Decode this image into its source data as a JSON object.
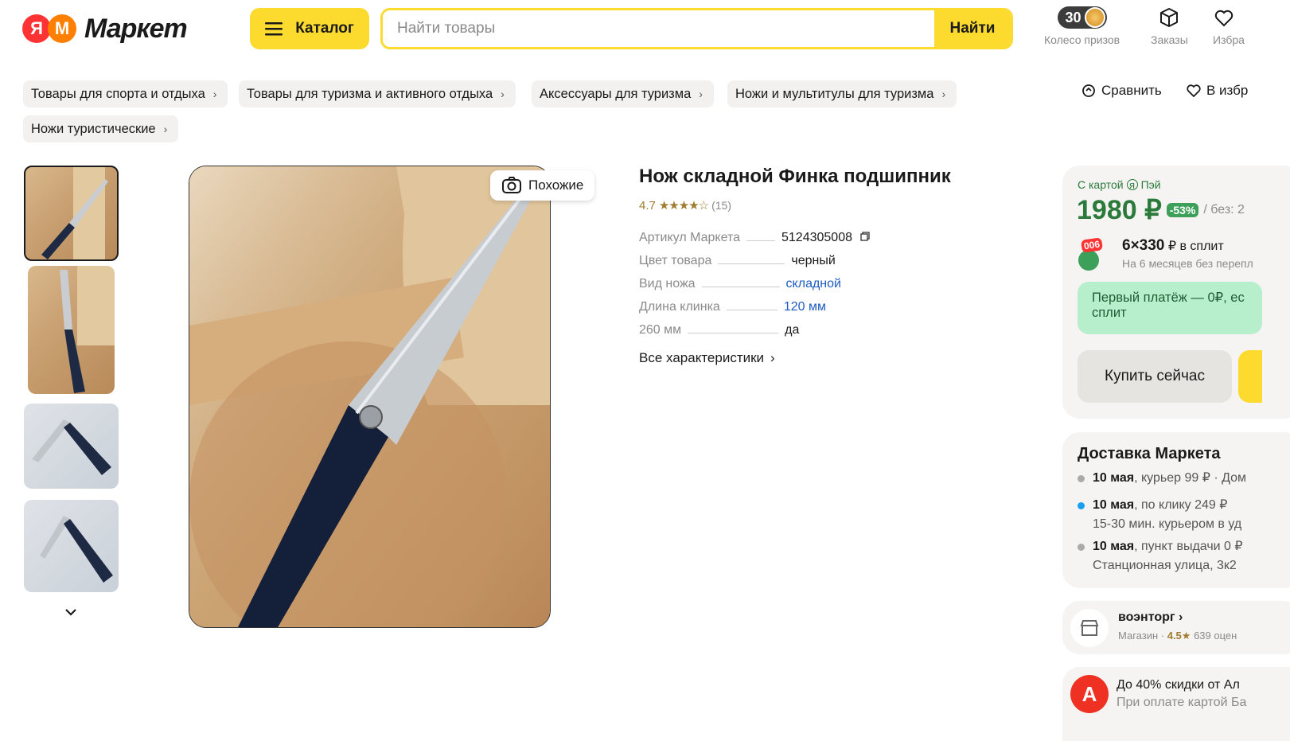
{
  "header": {
    "logo_letter": "Я",
    "logo_letter2": "М",
    "logo_word": "Маркет",
    "catalog_label": "Каталог",
    "search_placeholder": "Найти товары",
    "search_button": "Найти",
    "prize_count": "30",
    "prize_label": "Колесо призов",
    "orders_label": "Заказы",
    "favorites_label": "Избра"
  },
  "breadcrumbs": [
    "Товары для спорта и отдыха",
    "Товары для туризма и активного отдыха",
    "Аксессуары для туризма",
    "Ножи и мультитулы для туризма",
    "Ножи туристические"
  ],
  "actions": {
    "compare": "Сравнить",
    "favorite": "В избр"
  },
  "gallery": {
    "similar_label": "Похожие"
  },
  "product": {
    "title": "Нож складной Финка подшипник",
    "rating": "4.7",
    "reviews": "(15)",
    "specs": [
      {
        "name": "Артикул Маркета",
        "value": "5124305008"
      },
      {
        "name": "Цвет товара",
        "value": "черный"
      },
      {
        "name": "Вид ножа",
        "value": "складной"
      },
      {
        "name": "Длина клинка",
        "value": "120 мм"
      },
      {
        "name": "260 мм",
        "value": "да"
      }
    ],
    "all_chars": "Все характеристики"
  },
  "offer": {
    "card_label": "С картой",
    "pay_label": "Пэй",
    "price": "1980 ₽",
    "discount": "-53%",
    "without": "/ без: 2",
    "split_badge": "006",
    "split_price": "6×330",
    "split_suffix": "₽ в сплит",
    "split_note": "На 6 месяцев без перепл",
    "first_payment": "Первый платёж — 0₽, ес сплит",
    "buy_now": "Купить сейчас"
  },
  "delivery": {
    "title": "Доставка Маркета",
    "rows": [
      {
        "date": "10 мая",
        "text": ", курьер 99 ₽ · Дом",
        "sub": ""
      },
      {
        "date": "10 мая",
        "text": ", по клику 249 ₽",
        "sub": "15-30 мин. курьером в уд"
      },
      {
        "date": "10 мая",
        "text": ", пункт выдачи 0 ₽",
        "sub": "Станционная улица, 3к2"
      }
    ]
  },
  "shop": {
    "name": "воэнторг",
    "type": "Магазин",
    "rating": "4.5",
    "reviews": "639 оцен"
  },
  "promo": {
    "title": "До 40% скидки от Ал",
    "sub": "При оплате картой Ба"
  },
  "colors": {
    "brand_yellow": "#fcdb2e",
    "price_green": "#2b7a3b",
    "link_blue": "#1d5cc1"
  }
}
